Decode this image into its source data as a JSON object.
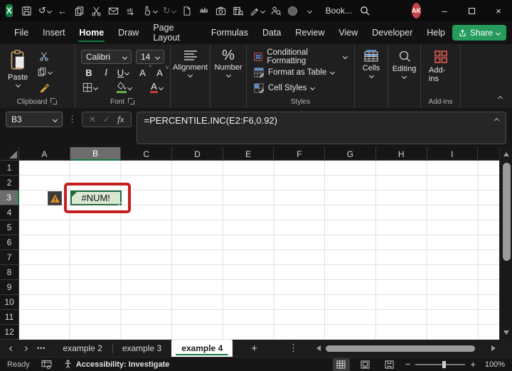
{
  "titlebar": {
    "title": "Book...",
    "avatar": "AK",
    "icons": [
      "excel-logo",
      "save",
      "undo",
      "back",
      "copy",
      "cut",
      "mail",
      "find-replace",
      "touch-mode",
      "redo",
      "new-file",
      "strikethrough",
      "camera",
      "lookup-sheet",
      "draft-pen",
      "person-search",
      "record-circle",
      "qat-overflow",
      "search",
      "minimize",
      "maximize",
      "close"
    ]
  },
  "menubar": {
    "items": [
      {
        "label": "File"
      },
      {
        "label": "Insert"
      },
      {
        "label": "Home",
        "active": true
      },
      {
        "label": "Draw"
      },
      {
        "label": "Page Layout"
      },
      {
        "label": "Formulas"
      },
      {
        "label": "Data"
      },
      {
        "label": "Review"
      },
      {
        "label": "View"
      },
      {
        "label": "Developer"
      },
      {
        "label": "Help"
      }
    ],
    "share_label": "Share"
  },
  "ribbon": {
    "paste_label": "Paste",
    "clipboard_group": "Clipboard",
    "font_name": "Calibri",
    "font_size": "14",
    "bold_label": "B",
    "italic_label": "I",
    "underline_label": "U",
    "grow_font_label": "A",
    "shrink_font_label": "A",
    "font_color_label": "A",
    "font_group": "Font",
    "alignment_label": "Alignment",
    "number_label": "Number",
    "number_icon": "%",
    "styles": {
      "conditional": "Conditional Formatting",
      "format_table": "Format as Table",
      "cell_styles": "Cell Styles",
      "group": "Styles"
    },
    "cells_label": "Cells",
    "editing_label": "Editing",
    "addins_label": "Add-ins",
    "addins_group": "Add-ins"
  },
  "formula_bar": {
    "cell_ref": "B3",
    "cancel_glyph": "✕",
    "enter_glyph": "✓",
    "fx_label": "fx",
    "formula": "=PERCENTILE.INC(E2:F6,0.92)"
  },
  "grid": {
    "columns": [
      {
        "label": "A"
      },
      {
        "label": "B",
        "selected": true
      },
      {
        "label": "C"
      },
      {
        "label": "D"
      },
      {
        "label": "E"
      },
      {
        "label": "F"
      },
      {
        "label": "G"
      },
      {
        "label": "H"
      },
      {
        "label": "I"
      }
    ],
    "rows": [
      {
        "label": "1"
      },
      {
        "label": "2"
      },
      {
        "label": "3",
        "selected": true
      },
      {
        "label": "4"
      },
      {
        "label": "5"
      },
      {
        "label": "6"
      },
      {
        "label": "7"
      },
      {
        "label": "8"
      },
      {
        "label": "9"
      },
      {
        "label": "10"
      },
      {
        "label": "11"
      },
      {
        "label": "12"
      }
    ],
    "error_cell": {
      "ref": "B3",
      "value": "#NUM!"
    }
  },
  "sheet_tabs": {
    "more_glyph": "•••",
    "tabs": [
      {
        "label": "example 2"
      },
      {
        "label": "example 3"
      },
      {
        "label": "example 4",
        "active": true
      }
    ],
    "new_sheet_glyph": "+",
    "menu_glyph": "⋮"
  },
  "status_bar": {
    "mode": "Ready",
    "accessibility": "Accessibility: Investigate",
    "zoom_minus": "−",
    "zoom_plus": "+",
    "zoom_level": "100%"
  },
  "colors": {
    "excel_green": "#107c41",
    "sel_green": "#1f6b40",
    "cell_fill": "#d9e8d3",
    "ann_red": "#c41f1f",
    "warn_orange": "#e2962d"
  }
}
